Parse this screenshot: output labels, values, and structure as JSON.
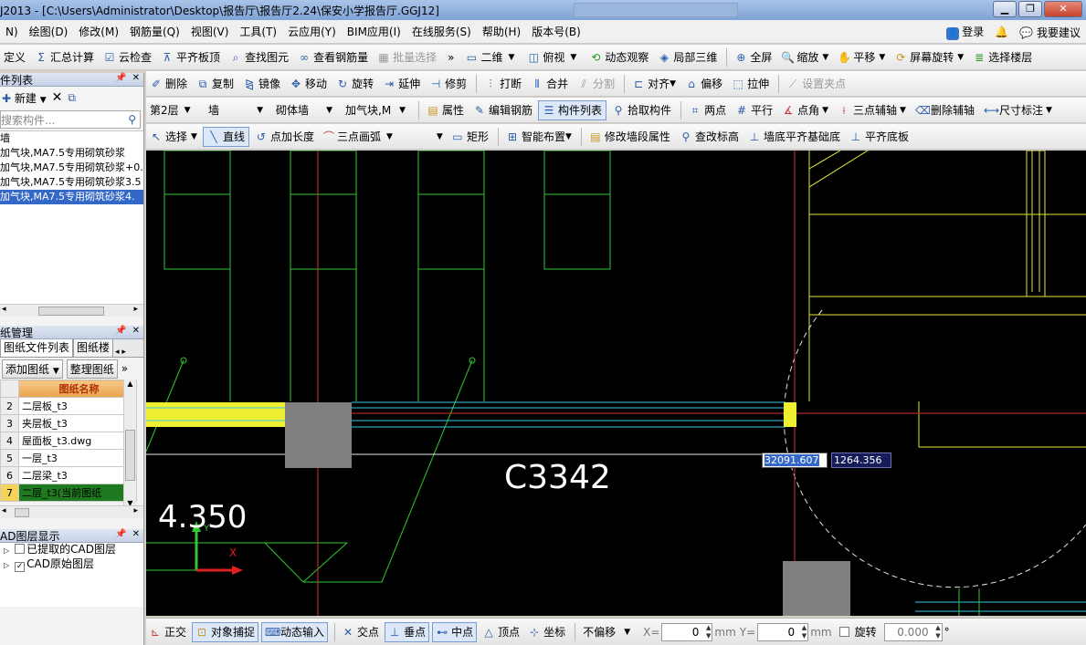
{
  "title": "J2013 - [C:\\Users\\Administrator\\Desktop\\报告厅\\报告厅2.24\\保安小学报告厅.GGJ12]",
  "menu": [
    "N)",
    "绘图(D)",
    "修改(M)",
    "钢筋量(Q)",
    "视图(V)",
    "工具(T)",
    "云应用(Y)",
    "BIM应用(I)",
    "在线服务(S)",
    "帮助(H)",
    "版本号(B)"
  ],
  "menu_right": {
    "login": "登录",
    "suggest": "我要建议"
  },
  "toolbar1": {
    "items": [
      "定义",
      "汇总计算",
      "云检查",
      "平齐板顶",
      "查找图元",
      "查看钢筋量",
      "批量选择"
    ],
    "view_mode": "二维",
    "view_dir": "俯视",
    "items2": [
      "动态观察",
      "局部三维",
      "全屏",
      "缩放",
      "平移",
      "屏幕旋转",
      "选择楼层"
    ]
  },
  "toolbar2": {
    "items": [
      "删除",
      "复制",
      "镜像",
      "移动",
      "旋转",
      "延伸",
      "修剪",
      "打断",
      "合并",
      "分割",
      "对齐",
      "偏移",
      "拉伸",
      "设置夹点"
    ]
  },
  "toolbar3": {
    "floor": "第2层",
    "category": "墙",
    "type": "砌体墙",
    "component": "加气块,M",
    "items": [
      "属性",
      "编辑钢筋",
      "构件列表",
      "拾取构件",
      "两点",
      "平行",
      "点角",
      "三点辅轴",
      "删除辅轴",
      "尺寸标注"
    ]
  },
  "toolbar4": {
    "items": [
      "选择",
      "直线",
      "点加长度",
      "三点画弧",
      "矩形",
      "智能布置",
      "修改墙段属性",
      "查改标高",
      "墙底平齐基础底",
      "平齐底板"
    ]
  },
  "component_list": {
    "header": "件列表",
    "new_label": "新建",
    "search_placeholder": "搜索构件...",
    "tree": [
      "墙",
      "加气块,MA7.5专用砌筑砂浆",
      "加气块,MA7.5专用砌筑砂浆+0.",
      "加气块,MA7.5专用砌筑砂浆3.5",
      "加气块,MA7.5专用砌筑砂浆4."
    ]
  },
  "drawing_mgmt": {
    "header": "纸管理",
    "tabs": [
      "图纸文件列表",
      "图纸楼"
    ],
    "add_label": "添加图纸",
    "organize_label": "整理图纸",
    "col_header": "图纸名称",
    "rows": [
      {
        "idx": "2",
        "name": "二层板_t3"
      },
      {
        "idx": "3",
        "name": "夹层板_t3"
      },
      {
        "idx": "4",
        "name": "屋面板_t3.dwg"
      },
      {
        "idx": "5",
        "name": "一层_t3"
      },
      {
        "idx": "6",
        "name": "二层梁_t3"
      },
      {
        "idx": "7",
        "name": "二层_t3(当前图纸"
      }
    ]
  },
  "cad_layers": {
    "header": "AD图层显示",
    "items": [
      {
        "label": "已提取的CAD图层",
        "checked": false
      },
      {
        "label": "CAD原始图层",
        "checked": true
      }
    ]
  },
  "canvas": {
    "label_window": "C3342",
    "label_elev": "4.350",
    "coord_x": "32091.607",
    "coord_y": "1264.356",
    "axis_y": "Y",
    "axis_x": "X"
  },
  "status": {
    "items": [
      "正交",
      "对象捕捉",
      "动态输入",
      "交点",
      "垂点",
      "中点",
      "顶点",
      "坐标"
    ],
    "offset_mode": "不偏移",
    "x_label": "X=",
    "x_value": "0",
    "mm": "mm",
    "y_label": "Y=",
    "y_value": "0",
    "rotate_label": "旋转",
    "rotate_value": "0.000",
    "deg": "°"
  }
}
